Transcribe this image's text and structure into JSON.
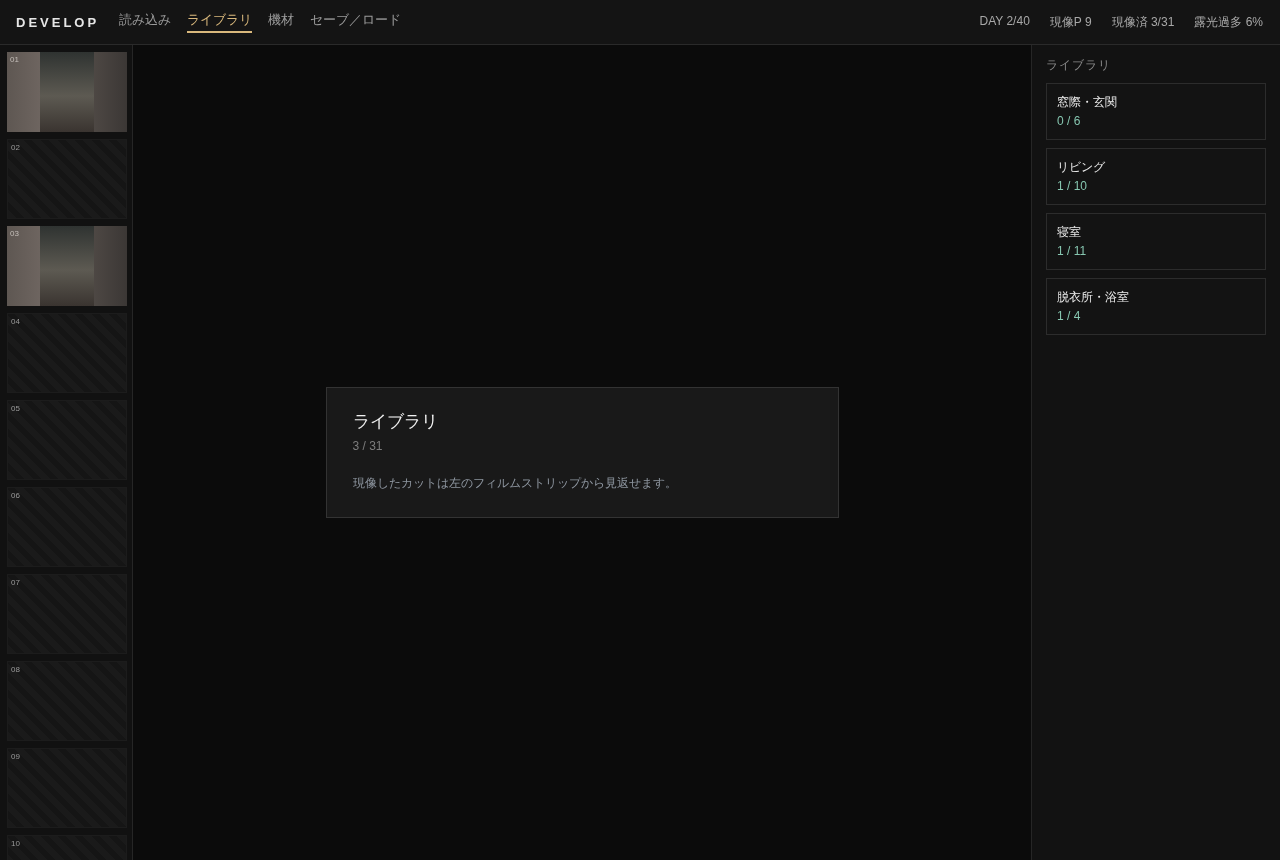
{
  "header": {
    "logo": "DEVELOP",
    "tabs": [
      {
        "label": "読み込み",
        "selected": false
      },
      {
        "label": "ライブラリ",
        "selected": true
      },
      {
        "label": "機材",
        "selected": false
      },
      {
        "label": "セーブ／ロード",
        "selected": false
      }
    ],
    "stats": [
      "DAY 2/40",
      "現像P 9",
      "現像済 3/31",
      "露光過多 6%"
    ]
  },
  "filmstrip": {
    "frames": [
      {
        "number": "01",
        "developed": true
      },
      {
        "number": "02",
        "developed": false
      },
      {
        "number": "03",
        "developed": true
      },
      {
        "number": "04",
        "developed": false
      },
      {
        "number": "05",
        "developed": false
      },
      {
        "number": "06",
        "developed": false
      },
      {
        "number": "07",
        "developed": false
      },
      {
        "number": "08",
        "developed": false
      },
      {
        "number": "09",
        "developed": false
      },
      {
        "number": "10",
        "developed": false
      }
    ]
  },
  "dialog": {
    "title": "ライブラリ",
    "count": "3 / 31",
    "message": "現像したカットは左のフィルムストリップから見返せます。"
  },
  "library": {
    "heading": "ライブラリ",
    "locations": [
      {
        "name": "窓際・玄関",
        "progress": "0 / 6"
      },
      {
        "name": "リビング",
        "progress": "1 / 10"
      },
      {
        "name": "寝室",
        "progress": "1 / 11"
      },
      {
        "name": "脱衣所・浴室",
        "progress": "1 / 4"
      }
    ]
  }
}
